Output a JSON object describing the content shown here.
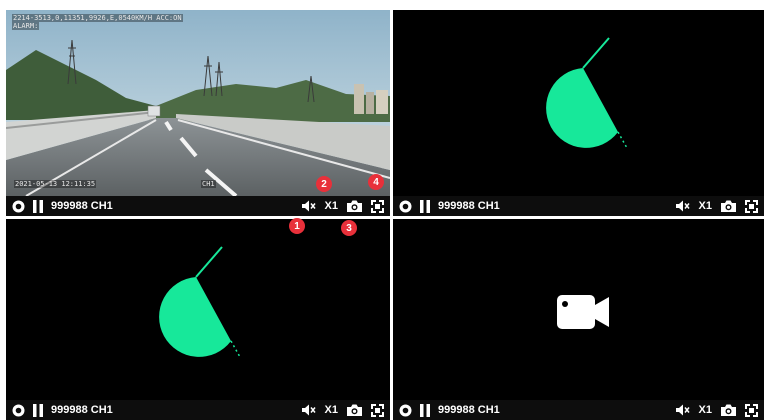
{
  "players": [
    {
      "device_channel": "999988 CH1",
      "speed": "X1",
      "osd": {
        "top_line1": "2214-3513,0,11351,9926,E,0540KM/H ACC:ON",
        "top_line2": "ALARM:",
        "bottom_left": "2021-05-13 12:11:35",
        "bottom_right": "CH1"
      }
    },
    {
      "device_channel": "999988 CH1",
      "speed": "X1"
    },
    {
      "device_channel": "999988 CH1",
      "speed": "X1"
    },
    {
      "device_channel": "999988 CH1",
      "speed": "X1"
    }
  ],
  "callouts": [
    "1",
    "2",
    "3",
    "4"
  ],
  "icons": {
    "record": "record-icon",
    "pause": "pause-icon",
    "mute": "mute-icon",
    "snapshot": "camera-icon",
    "fullscreen": "fullscreen-icon",
    "loading": "loading-spinner-icon",
    "no_video": "video-camera-icon"
  },
  "colors": {
    "spinner": "#17e89a",
    "callout": "#e8303a",
    "tile_bg": "#000000"
  }
}
